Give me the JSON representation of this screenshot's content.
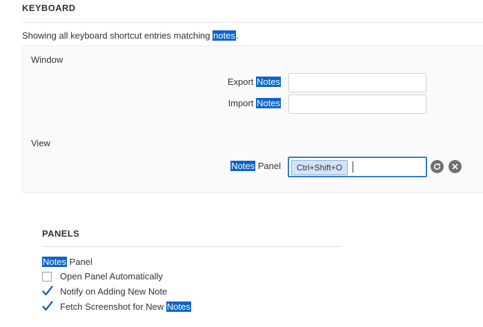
{
  "keyboard": {
    "title": "KEYBOARD",
    "description_prefix": "Showing all keyboard shortcut entries matching ",
    "search_term": "notes",
    "description_suffix": ".",
    "groups": [
      {
        "title": "Window",
        "rows": [
          {
            "label_pre": "Export ",
            "label_hl": "Notes",
            "label_post": "",
            "value": ""
          },
          {
            "label_pre": "Import ",
            "label_hl": "Notes",
            "label_post": "",
            "value": ""
          }
        ]
      },
      {
        "title": "View",
        "rows": [
          {
            "label_pre": "",
            "label_hl": "Notes",
            "label_post": " Panel",
            "value": "Ctrl+Shift+O"
          }
        ]
      }
    ],
    "reset_icon": "reset-icon",
    "clear_icon": "clear-icon"
  },
  "panels": {
    "title": "PANELS",
    "subheading_hl": "Notes",
    "subheading_post": " Panel",
    "options": [
      {
        "label_pre": "Open Panel Automatically",
        "label_hl": "",
        "checked": false
      },
      {
        "label_pre": "Notify on Adding New Note",
        "label_hl": "",
        "checked": true
      },
      {
        "label_pre": "Fetch Screenshot for New ",
        "label_hl": "Notes",
        "checked": true
      }
    ]
  },
  "colors": {
    "highlight": "#0a64cd",
    "checkmark": "#1a5fb4",
    "active_border": "#2e7bcf",
    "chip_bg": "#d4e4f7"
  }
}
